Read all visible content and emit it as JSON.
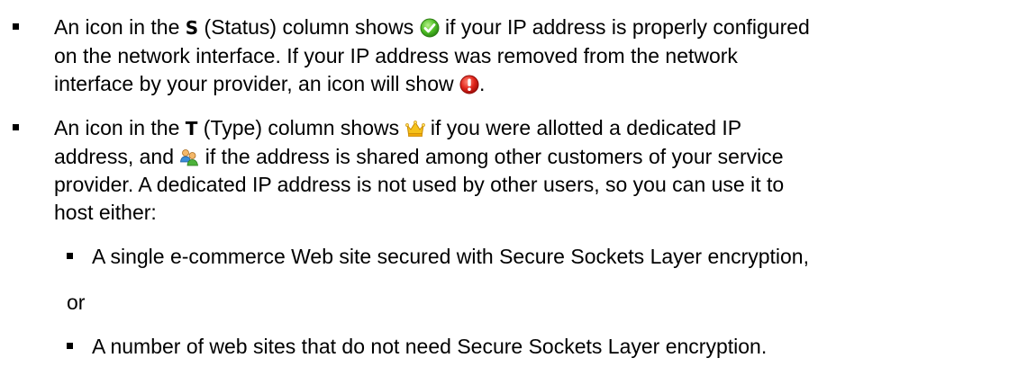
{
  "item1": {
    "line1": {
      "a": "An icon in the ",
      "col": "S",
      "b": " (Status) column shows ",
      "c": " if your IP address is properly configured"
    },
    "line2": "on the network interface. If your IP address was removed from the network",
    "line3": {
      "a": "interface by your provider, an icon will show ",
      "b": "."
    },
    "icons": {
      "ok": "green-check-icon",
      "error": "red-exclamation-icon"
    }
  },
  "item2": {
    "line1": {
      "a": "An icon in the ",
      "col": "T",
      "b": " (Type) column shows ",
      "c": " if you were allotted a dedicated IP"
    },
    "line2": {
      "a": "address, and ",
      "b": " if the address is shared among other customers of your service"
    },
    "line3": "provider. A dedicated IP address is not used by other users, so you can use it to",
    "line4": "host either:",
    "icons": {
      "dedicated": "crown-icon",
      "shared": "shared-users-icon"
    }
  },
  "sub1": "A single e-commerce Web site secured with Secure Sockets Layer encryption,",
  "or": "or",
  "sub2": "A number of web sites that do not need Secure Sockets Layer encryption."
}
